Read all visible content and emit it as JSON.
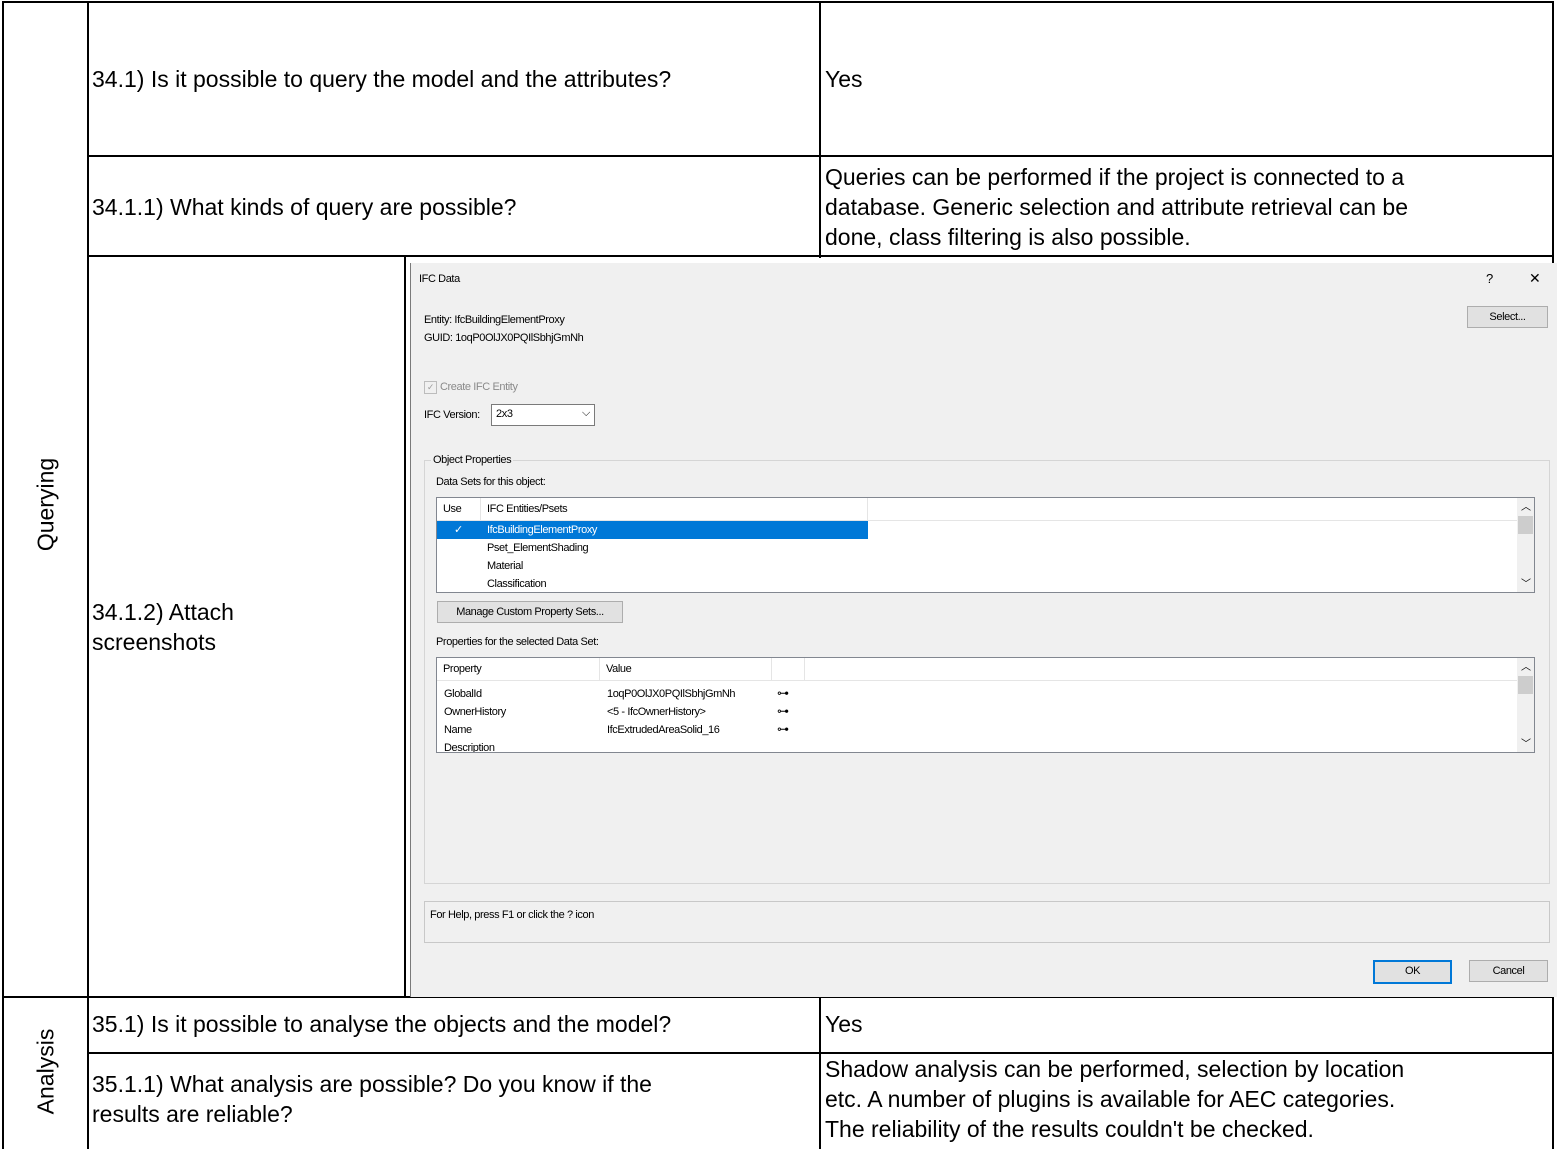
{
  "sections": {
    "querying": "Querying",
    "analysis": "Analysis"
  },
  "rows": {
    "q34_1": {
      "question": "34.1) Is it possible to query the model and the attributes?",
      "answer": "Yes"
    },
    "q34_1_1": {
      "question": "34.1.1) What kinds of query are possible?",
      "answer_lines": [
        "Queries can be performed if the project is connected to a",
        "database. Generic selection and attribute retrieval can be",
        "done, class filtering is also possible."
      ]
    },
    "q34_1_2": {
      "question_lines": [
        "34.1.2) Attach",
        "screenshots"
      ]
    },
    "q35_1": {
      "question": "35.1) Is it possible to analyse the objects and the model?",
      "answer": "Yes"
    },
    "q35_1_1": {
      "question_lines": [
        "35.1.1) What analysis are possible? Do you know if the",
        "results are reliable?"
      ],
      "answer_lines": [
        "Shadow analysis can be performed, selection by location",
        "etc. A number of plugins is available for AEC categories.",
        "The reliability of the results couldn't be checked."
      ]
    }
  },
  "dialog": {
    "title": "IFC Data",
    "help_glyph": "?",
    "close_glyph": "✕",
    "entity_line": "Entity:  IfcBuildingElementProxy",
    "guid_line": "GUID:  1oqP0OlJX0PQIlSbhjGmNh",
    "select_button": "Select...",
    "create_entity_label": "Create IFC Entity",
    "ifc_version_label": "IFC Version:",
    "ifc_version_value": "2x3",
    "object_properties_group": "Object Properties",
    "data_sets_label": "Data Sets for this object:",
    "data_sets_headers": {
      "use": "Use",
      "entities": "IFC Entities/Psets"
    },
    "data_sets": [
      {
        "check": "✓",
        "name": "IfcBuildingElementProxy",
        "selected": true
      },
      {
        "check": "",
        "name": "Pset_ElementShading",
        "selected": false
      },
      {
        "check": "",
        "name": "Material",
        "selected": false
      },
      {
        "check": "",
        "name": "Classification",
        "selected": false
      }
    ],
    "manage_button": "Manage Custom Property Sets...",
    "properties_label": "Properties for the selected Data Set:",
    "properties_headers": {
      "property": "Property",
      "value": "Value"
    },
    "properties": [
      {
        "property": "GlobalId",
        "value": "1oqP0OlJX0PQIlSbhjGmNh"
      },
      {
        "property": "OwnerHistory",
        "value": "<5 - IfcOwnerHistory>"
      },
      {
        "property": "Name",
        "value": "IfcExtrudedAreaSolid_16"
      },
      {
        "property": "Description",
        "value": ""
      }
    ],
    "help_text": "For Help, press F1 or click the ? icon",
    "ok_button": "OK",
    "cancel_button": "Cancel",
    "selection_color": "#0078d7"
  }
}
